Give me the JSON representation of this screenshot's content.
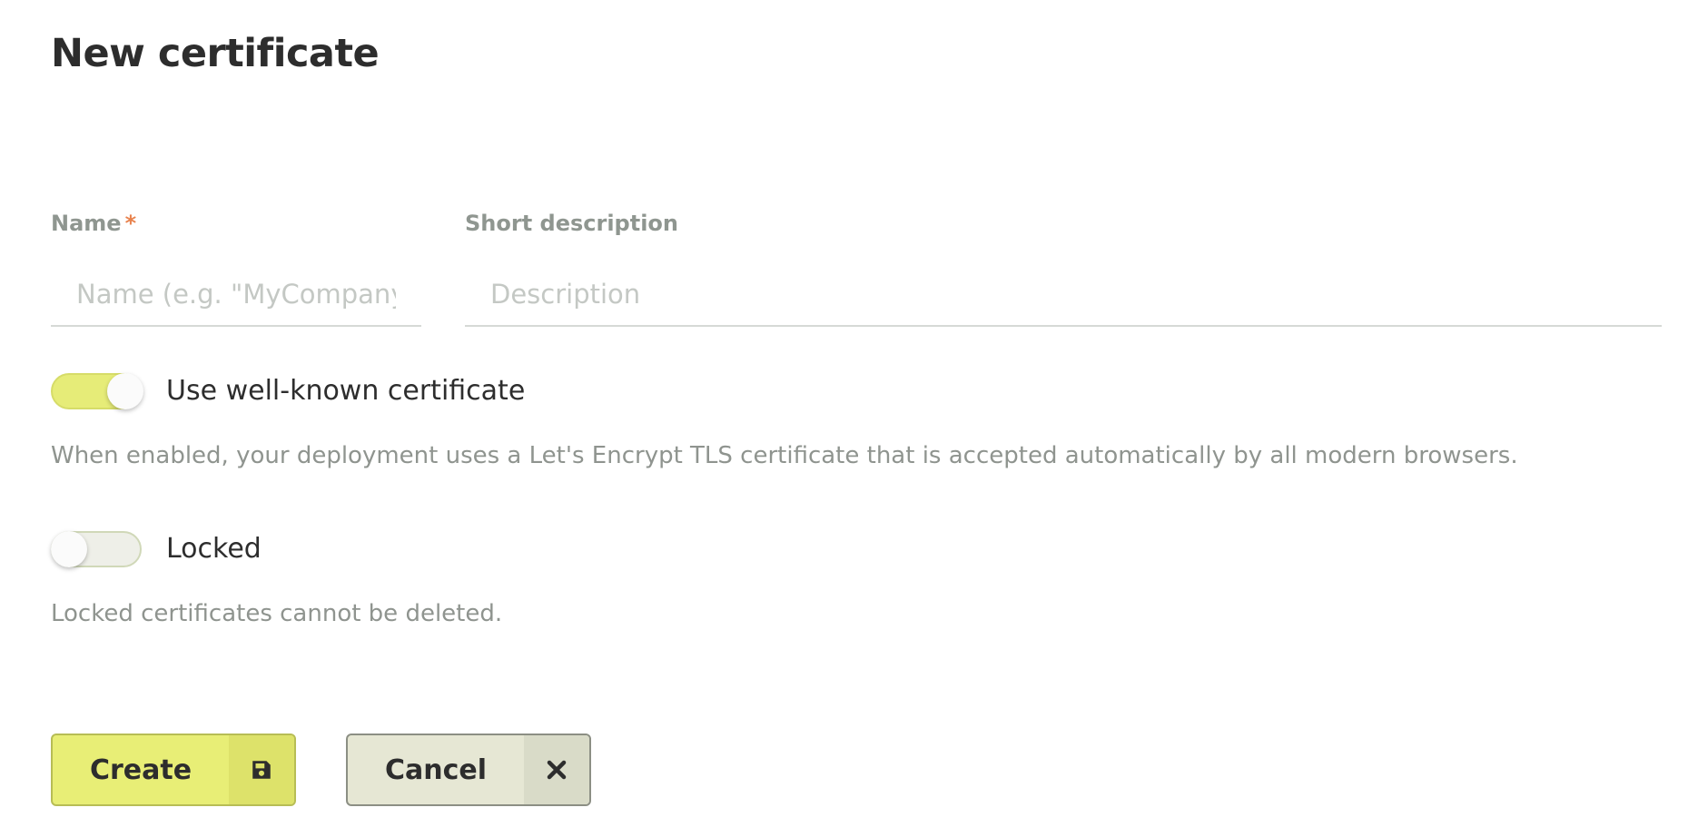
{
  "page": {
    "title": "New certificate"
  },
  "form": {
    "name": {
      "label": "Name",
      "required_mark": "*",
      "placeholder": "Name (e.g. \"MyCompany",
      "value": ""
    },
    "description": {
      "label": "Short description",
      "placeholder": "Description",
      "value": ""
    },
    "well_known": {
      "label": "Use well-known certificate",
      "enabled": true,
      "help": "When enabled, your deployment uses a Let's Encrypt TLS certificate that is accepted automatically by all modern browsers."
    },
    "locked": {
      "label": "Locked",
      "enabled": false,
      "help": "Locked certificates cannot be deleted."
    }
  },
  "actions": {
    "create_label": "Create",
    "create_icon": "floppy-disk-icon",
    "cancel_label": "Cancel",
    "cancel_icon": "close-icon"
  },
  "colors": {
    "accent": "#e8ee76",
    "required": "#e8824d",
    "cancel_bg": "#e6e7d4"
  }
}
